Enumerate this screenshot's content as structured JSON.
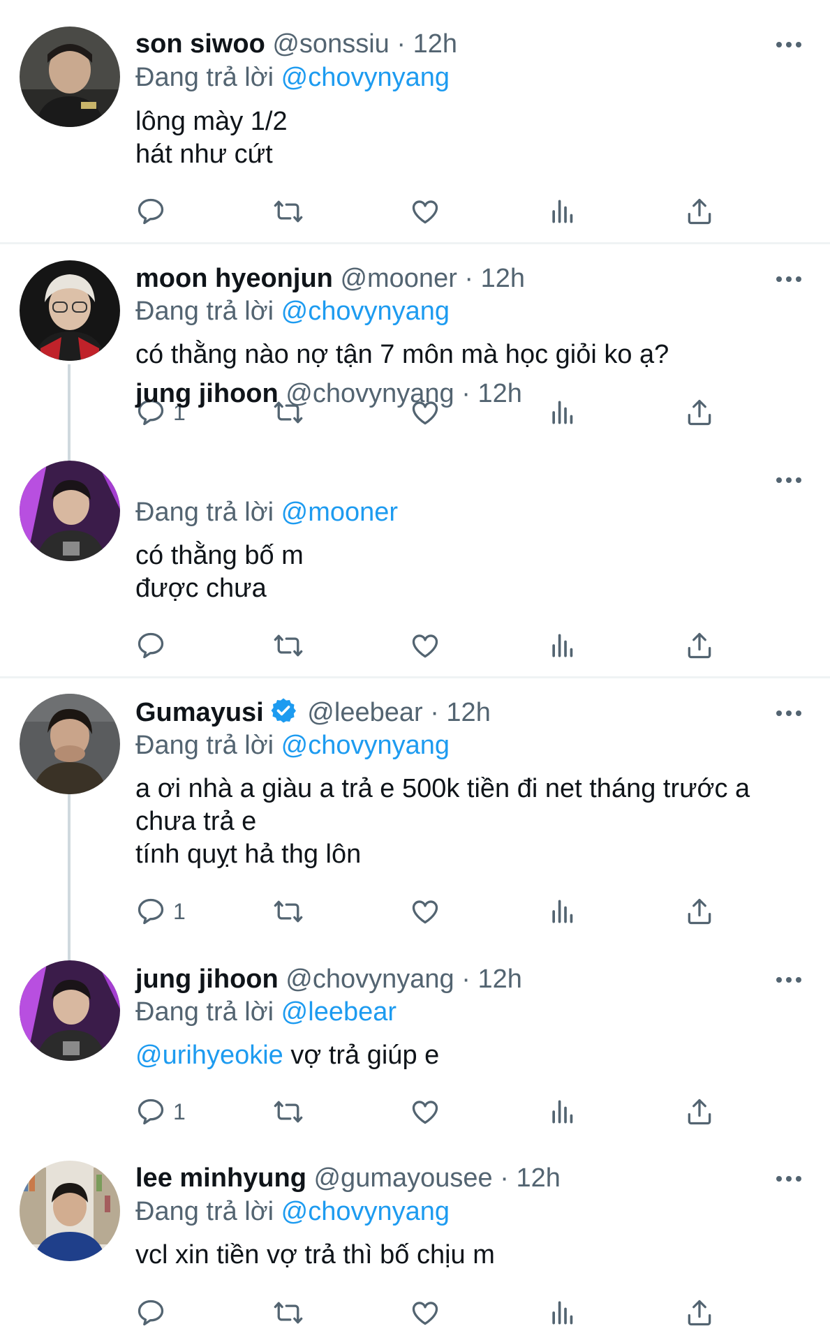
{
  "reply_prefix": "Đang trả lời",
  "dot": "·",
  "icons": {
    "reply": "reply-icon",
    "retweet": "retweet-icon",
    "like": "heart-icon",
    "views": "views-icon",
    "share": "share-icon",
    "more": "more-icon",
    "verified": "verified-badge-icon"
  },
  "colors": {
    "link": "#1d9bf0",
    "muted": "#536471",
    "text": "#0f1419",
    "thread": "#cfd9de"
  },
  "tweets": [
    {
      "name": "son siwoo",
      "handle": "@sonssiu",
      "time": "12h",
      "replying_to": "@chovynyang",
      "lines": [
        "lông mày 1/2",
        "hát như cứt"
      ],
      "reply_count": ""
    },
    {
      "name": "moon hyeonjun",
      "handle": "@mooner",
      "time": "12h",
      "replying_to": "@chovynyang",
      "lines": [
        "có thằng nào nợ tận 7 môn mà học giỏi ko ạ?"
      ],
      "reply_count": "1"
    },
    {
      "name": "jung jihoon",
      "handle": "@chovynyang",
      "time": "12h",
      "replying_to": "@mooner",
      "lines": [
        "có thằng bố m",
        "được chưa"
      ],
      "reply_count": ""
    },
    {
      "name": "Gumayusi",
      "verified": true,
      "handle": "@leebear",
      "time": "12h",
      "replying_to": "@chovynyang",
      "lines": [
        "a ơi nhà a giàu a trả e 500k tiền đi net tháng trước a",
        "chưa trả e",
        "tính quỵt hả thg lôn"
      ],
      "reply_count": "1"
    },
    {
      "name": "jung jihoon",
      "handle": "@chovynyang",
      "time": "12h",
      "replying_to": "@leebear",
      "mention": "@urihyeokie",
      "lines": [
        " vợ trả giúp e"
      ],
      "reply_count": "1"
    },
    {
      "name": "lee minhyung",
      "handle": "@gumayousee",
      "time": "12h",
      "replying_to": "@chovynyang",
      "lines": [
        "vcl xin tiền vợ trả thì bố chịu m"
      ],
      "reply_count": ""
    }
  ]
}
